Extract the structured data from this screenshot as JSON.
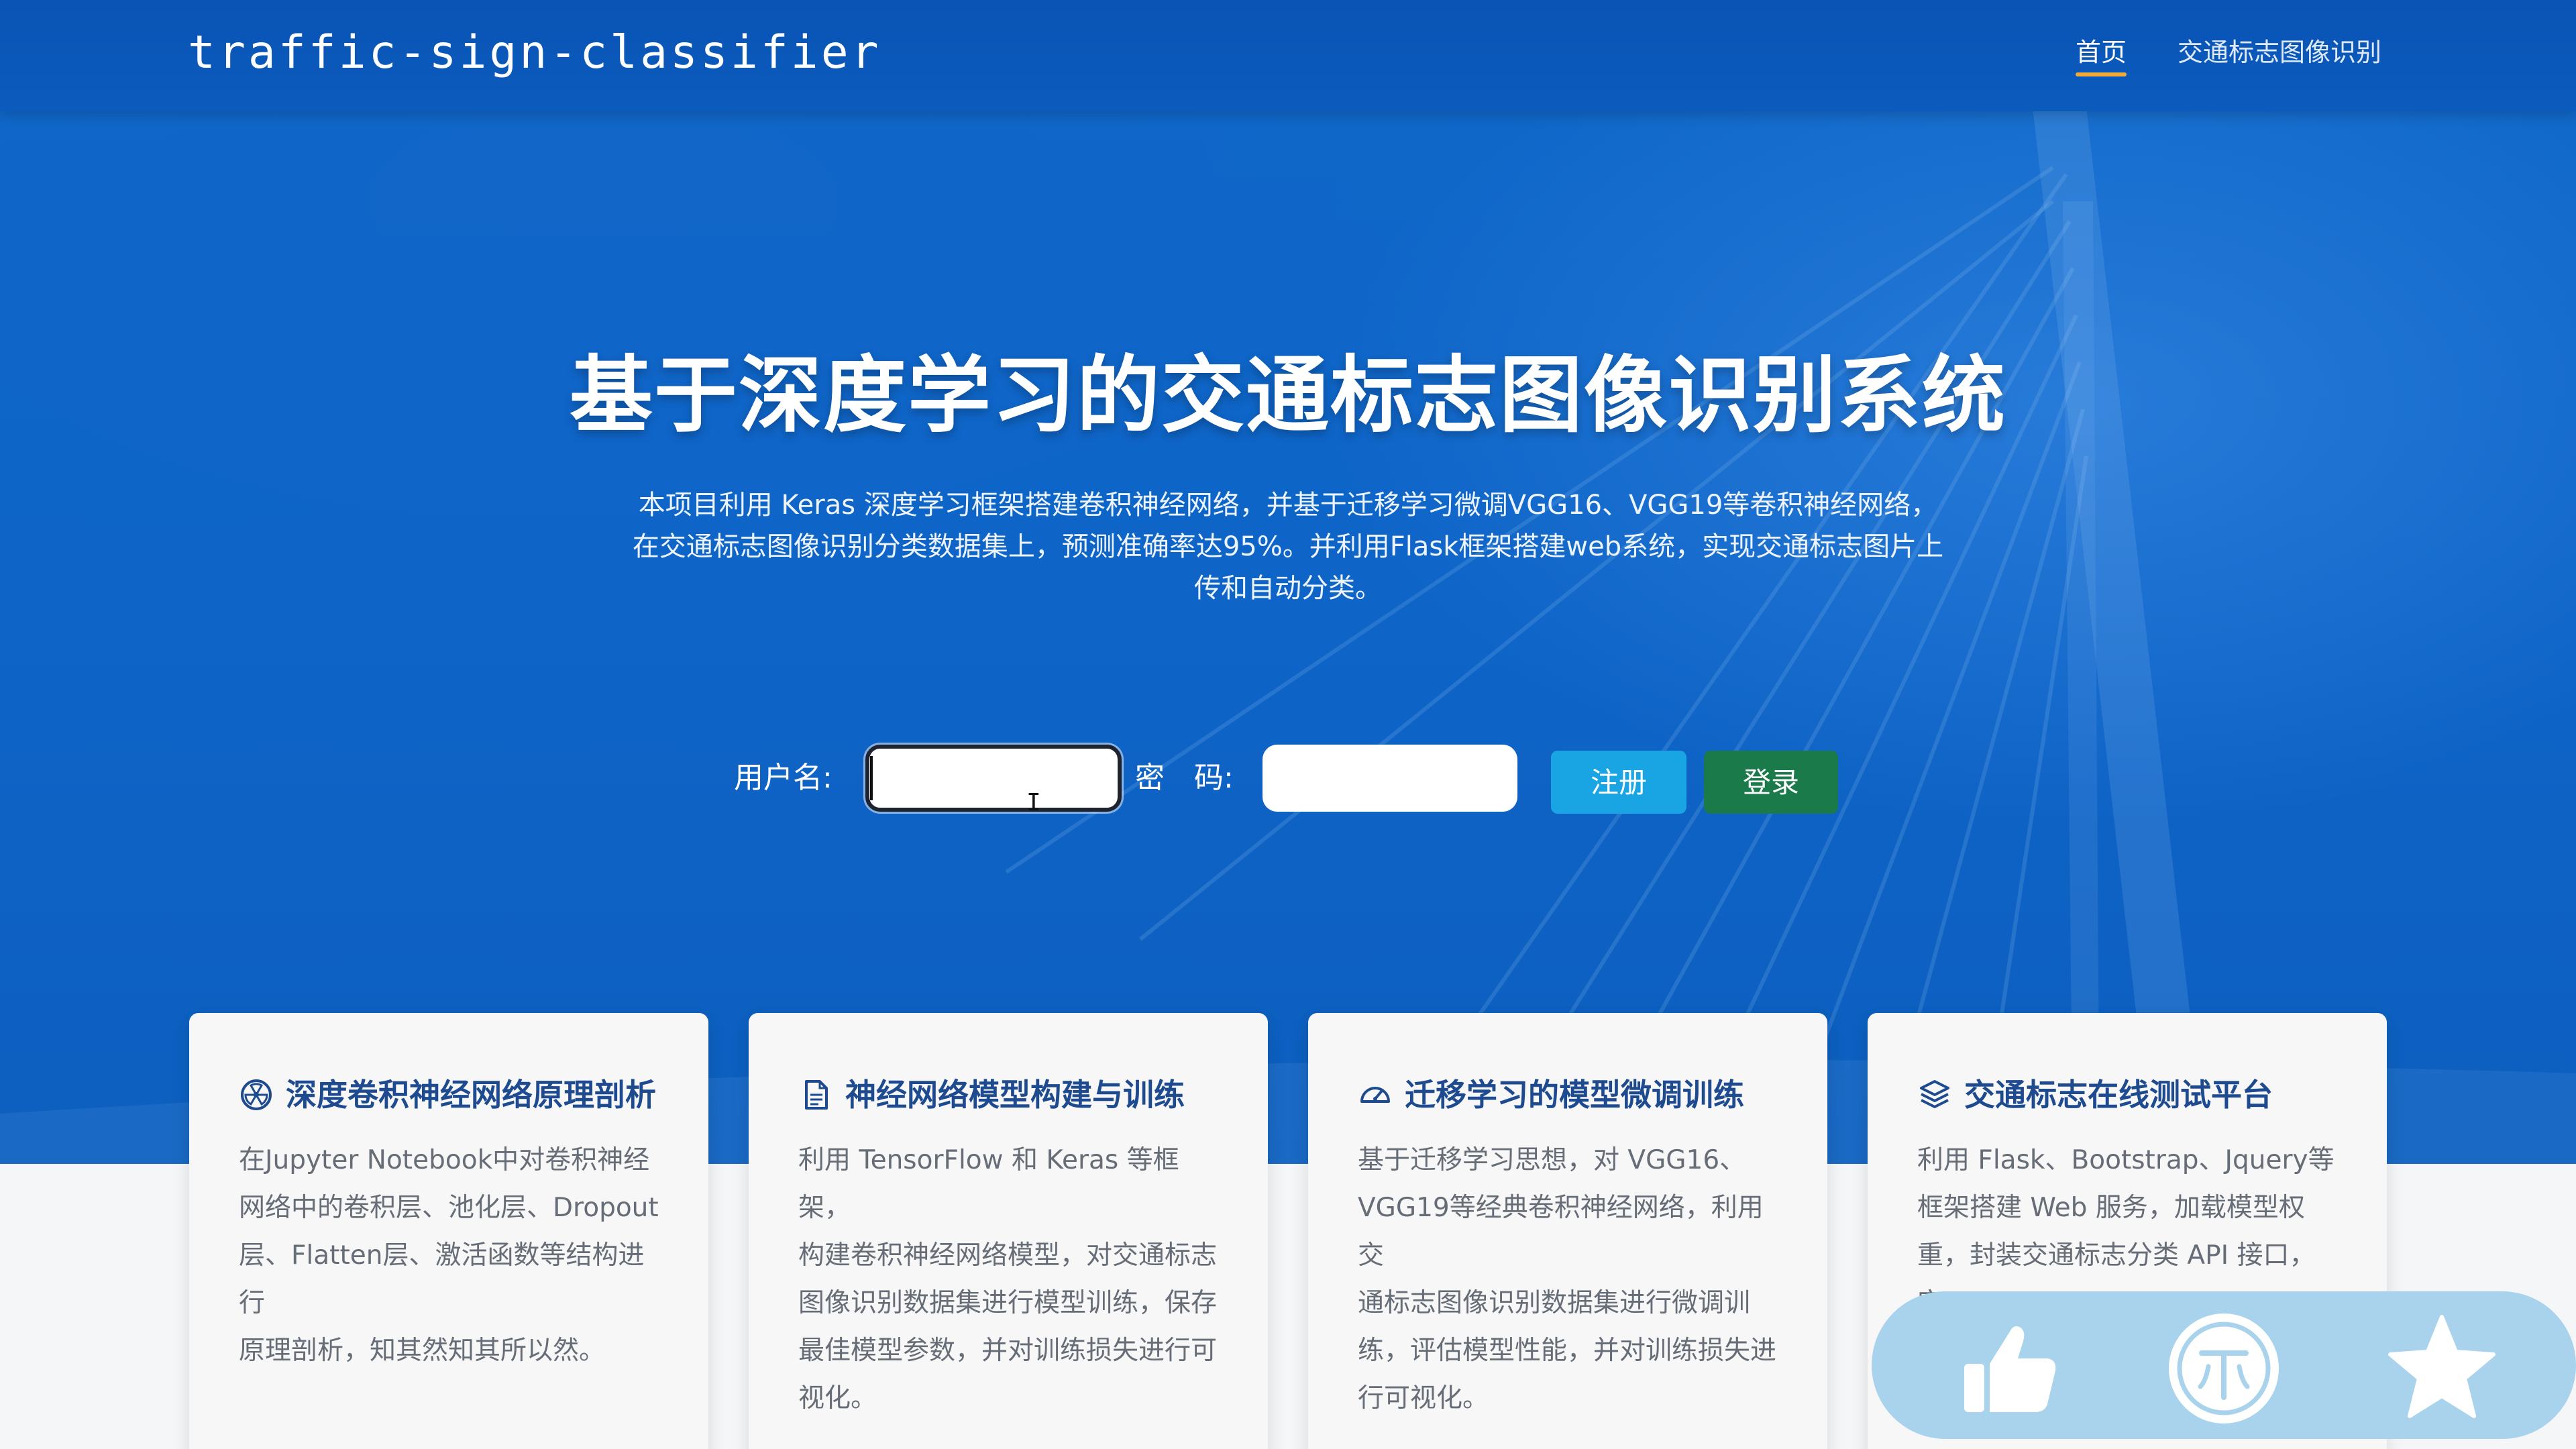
{
  "navbar": {
    "brand": "traffic-sign-classifier",
    "items": [
      {
        "label": "首页",
        "active": true
      },
      {
        "label": "交通标志图像识别",
        "active": false
      }
    ],
    "active_underline_color": "#f0a93b"
  },
  "hero": {
    "title": "基于深度学习的交通标志图像识别系统",
    "intro_lines": [
      "本项目利用 Keras 深度学习框架搭建卷积神经网络，并基于迁移学习微调VGG16、VGG19等卷积神经网络，",
      "在交通标志图像识别分类数据集上，预测准确率达95%。并利用Flask框架搭建web系统，实现交通标志图片上",
      "传和自动分类。"
    ]
  },
  "login_form": {
    "username_label": "用户名:",
    "username_value": "",
    "password_label": "密　码:",
    "password_value": "",
    "register_button": "注册",
    "login_button": "登录"
  },
  "cards": [
    {
      "icon": "radiation-icon",
      "title": "深度卷积神经网络原理剖析",
      "lines": [
        "在Jupyter Notebook中对卷积神经",
        "网络中的卷积层、池化层、Dropout",
        "层、Flatten层、激活函数等结构进行",
        "原理剖析，知其然知其所以然。"
      ]
    },
    {
      "icon": "document-icon",
      "title": "神经网络模型构建与训练",
      "lines": [
        "利用 TensorFlow 和 Keras 等框架，",
        "构建卷积神经网络模型，对交通标志",
        "图像识别数据集进行模型训练，保存",
        "最佳模型参数，并对训练损失进行可",
        "视化。"
      ]
    },
    {
      "icon": "speedometer-icon",
      "title": "迁移学习的模型微调训练",
      "lines": [
        "基于迁移学习思想，对 VGG16、",
        "VGG19等经典卷积神经网络，利用交",
        "通标志图像识别数据集进行微调训",
        "练，评估模型性能，并对训练损失进",
        "行可视化。"
      ]
    },
    {
      "icon": "layers-icon",
      "title": "交通标志在线测试平台",
      "lines": [
        "利用 Flask、Bootstrap、Jquery等",
        "框架搭建 Web 服务，加载模型权",
        "重，封装交通标志分类 API 接口，实"
      ]
    }
  ],
  "floating_actions": [
    {
      "icon": "thumbs-up-icon"
    },
    {
      "icon": "coin-icon"
    },
    {
      "icon": "star-icon"
    }
  ],
  "colors": {
    "hero_blue": "#0e64c7",
    "card_title": "#1e4b8f",
    "register_button": "#19a5e3",
    "login_button": "#1b7a4a",
    "fab_bar": "#a9d3ec"
  }
}
